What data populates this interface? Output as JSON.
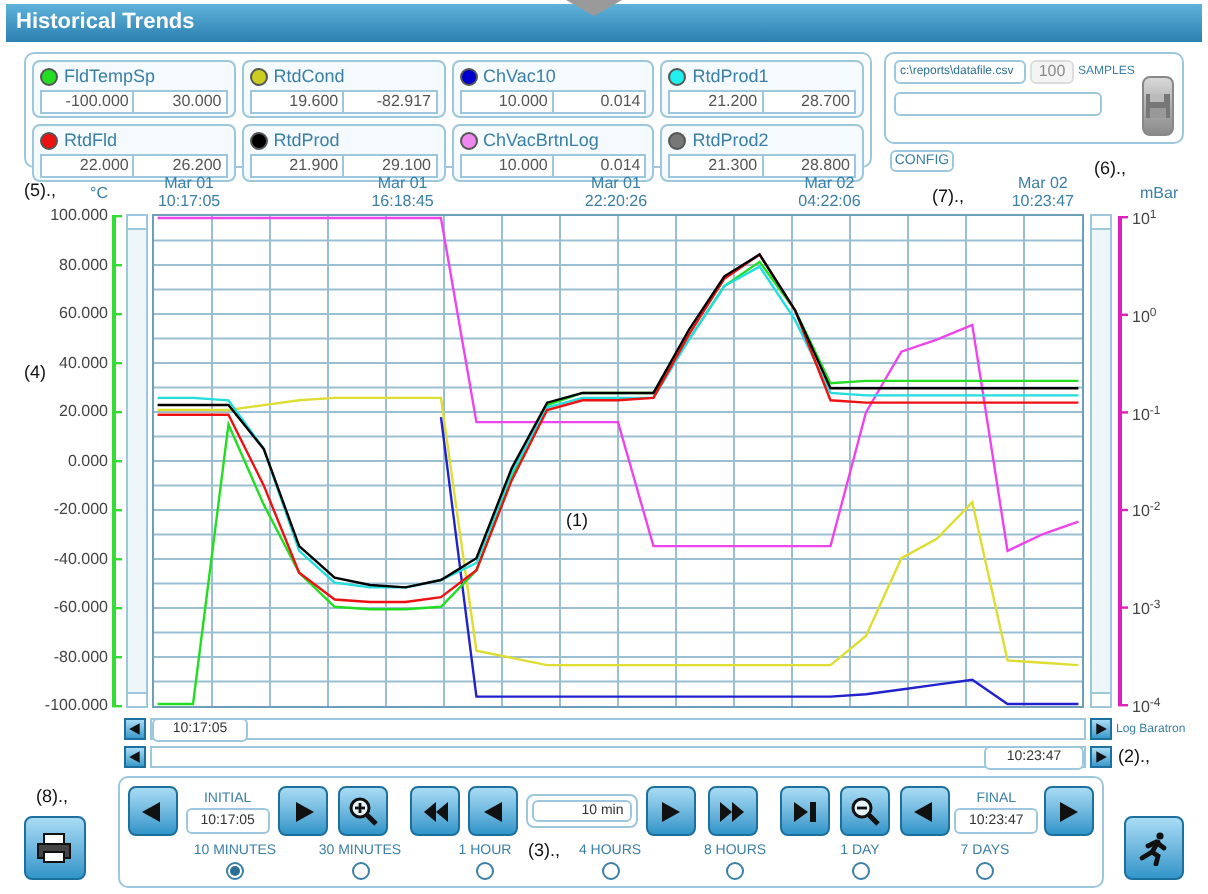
{
  "window": {
    "title": "Historical Trends"
  },
  "tags": [
    {
      "name": "FldTempSp",
      "color": "#22dd22",
      "min": "-100.000",
      "max": "30.000"
    },
    {
      "name": "RtdCond",
      "color": "#cccc22",
      "min": "19.600",
      "max": "-82.917"
    },
    {
      "name": "ChVac10",
      "color": "#0000cc",
      "min": "10.000",
      "max": "0.014"
    },
    {
      "name": "RtdProd1",
      "color": "#22eeee",
      "min": "21.200",
      "max": "28.700"
    },
    {
      "name": "RtdFld",
      "color": "#ee1111",
      "min": "22.000",
      "max": "26.200"
    },
    {
      "name": "RtdProd",
      "color": "#000000",
      "min": "21.900",
      "max": "29.100"
    },
    {
      "name": "ChVacBrtnLog",
      "color": "#ee88ee",
      "min": "10.000",
      "max": "0.014"
    },
    {
      "name": "RtdProd2",
      "color": "#777777",
      "min": "21.300",
      "max": "28.800"
    }
  ],
  "export": {
    "file_path": "c:\\reports\\datafile.csv",
    "samples": "100",
    "samples_disabled": true,
    "samples_label": "SAMPLES"
  },
  "config_button": "CONFIG",
  "callouts": {
    "chart_left": "(5).,",
    "config": "(7).,",
    "chart_right": "(6).,",
    "axis": "(4)",
    "plot": "(1)",
    "scroll": "(2).,",
    "print": "(8).,",
    "ranges": "(3).,"
  },
  "chart": {
    "left_unit": "°C",
    "right_unit": "mBar",
    "right_ticks": [
      "10$^{1}$",
      "10$^{0}$",
      "10$^{-1}$",
      "10$^{-2}$",
      "10$^{-3}$",
      "10$^{-4}$"
    ],
    "chart_data": {
      "type": "line",
      "grid": true,
      "ylim": [
        -100,
        100
      ],
      "categories": [
        null,
        "Mar 01 10:17:05",
        null,
        null,
        null,
        null,
        null,
        "Mar 01 16:18:45",
        null,
        null,
        null,
        null,
        null,
        "Mar 01 22:20:26",
        null,
        null,
        null,
        null,
        null,
        "Mar 02 04:22:06",
        null,
        null,
        null,
        null,
        null,
        "Mar 02 10:23:47",
        null
      ],
      "yticks": [
        {
          "value": 100,
          "label": "100.000"
        },
        {
          "value": 80,
          "label": "80.000"
        },
        {
          "value": 60,
          "label": "60.000"
        },
        {
          "value": 40,
          "label": "40.000"
        },
        {
          "value": 20,
          "label": "20.000"
        },
        {
          "value": 0,
          "label": "0.000"
        },
        {
          "value": -20,
          "label": "-20.000"
        },
        {
          "value": -40,
          "label": "-40.000"
        },
        {
          "value": -60,
          "label": "-60.000"
        },
        {
          "value": -80,
          "label": "-80.000"
        },
        {
          "value": -100,
          "label": "-100.000"
        }
      ],
      "series": [
        {
          "color": "#ee44ee",
          "values": [
            100,
            100,
            100,
            100,
            100,
            100,
            100,
            100,
            100,
            16,
            16,
            16,
            16,
            16,
            -35,
            -35,
            -35,
            -35,
            -35,
            -35,
            20,
            45,
            50,
            56,
            -37,
            -30,
            -25
          ]
        },
        {
          "color": "#dddd33",
          "values": [
            21,
            21,
            21,
            23,
            25,
            26,
            26,
            26,
            26,
            -78,
            -81,
            -84,
            -84,
            -84,
            -84,
            -84,
            -84,
            -84,
            -84,
            -84,
            -72,
            -40,
            -32,
            -17,
            -82,
            -83,
            -84
          ]
        },
        {
          "color": "#2222cc",
          "values": [
            null,
            null,
            null,
            null,
            null,
            null,
            null,
            null,
            18,
            -97,
            -97,
            -97,
            -97,
            -97,
            -97,
            -97,
            -97,
            -97,
            -97,
            -97,
            -96,
            -94,
            -92,
            -90,
            -100,
            -100,
            -100
          ]
        },
        {
          "color": "#22dd22",
          "values": [
            -100,
            -100,
            15,
            -18,
            -46,
            -60,
            -61,
            -61,
            -60,
            -45,
            -7,
            23,
            28,
            28,
            28,
            50,
            72,
            82,
            62,
            32,
            33,
            33,
            33,
            33,
            33,
            33,
            33
          ]
        },
        {
          "color": "#22dddd",
          "values": [
            26,
            26,
            25,
            5,
            -37,
            -50,
            -52,
            -52,
            -49,
            -42,
            -5,
            22,
            26,
            26,
            26,
            50,
            72,
            80,
            58,
            28,
            27,
            27,
            27,
            27,
            27,
            27,
            27
          ]
        },
        {
          "color": "#ee1111",
          "values": [
            19,
            19,
            19,
            -10,
            -46,
            -57,
            -58,
            -58,
            -56,
            -45,
            -8,
            21,
            25,
            25,
            26,
            52,
            75,
            85,
            62,
            25,
            24,
            24,
            24,
            24,
            24,
            24,
            24
          ]
        },
        {
          "color": "#000000",
          "values": [
            23,
            23,
            23,
            5,
            -35,
            -48,
            -51,
            -52,
            -49,
            -40,
            -3,
            24,
            28,
            28,
            28,
            54,
            76,
            85,
            62,
            30,
            30,
            30,
            30,
            30,
            30,
            30,
            30
          ]
        }
      ]
    }
  },
  "scroll": {
    "start_time": "10:17:05",
    "end_time": "10:23:47",
    "axis_name": "Log Baratron"
  },
  "controls": {
    "initial_label": "INITIAL",
    "initial_time": "10:17:05",
    "span": "10 min",
    "final_label": "FINAL",
    "final_time": "10:23:47",
    "ranges": [
      {
        "label": "10 MINUTES",
        "selected": true
      },
      {
        "label": "30 MINUTES",
        "selected": false
      },
      {
        "label": "1 HOUR",
        "selected": false
      },
      {
        "label": "4 HOURS",
        "selected": false
      },
      {
        "label": "8 HOURS",
        "selected": false
      },
      {
        "label": "1 DAY",
        "selected": false
      },
      {
        "label": "7 DAYS",
        "selected": false
      }
    ]
  }
}
